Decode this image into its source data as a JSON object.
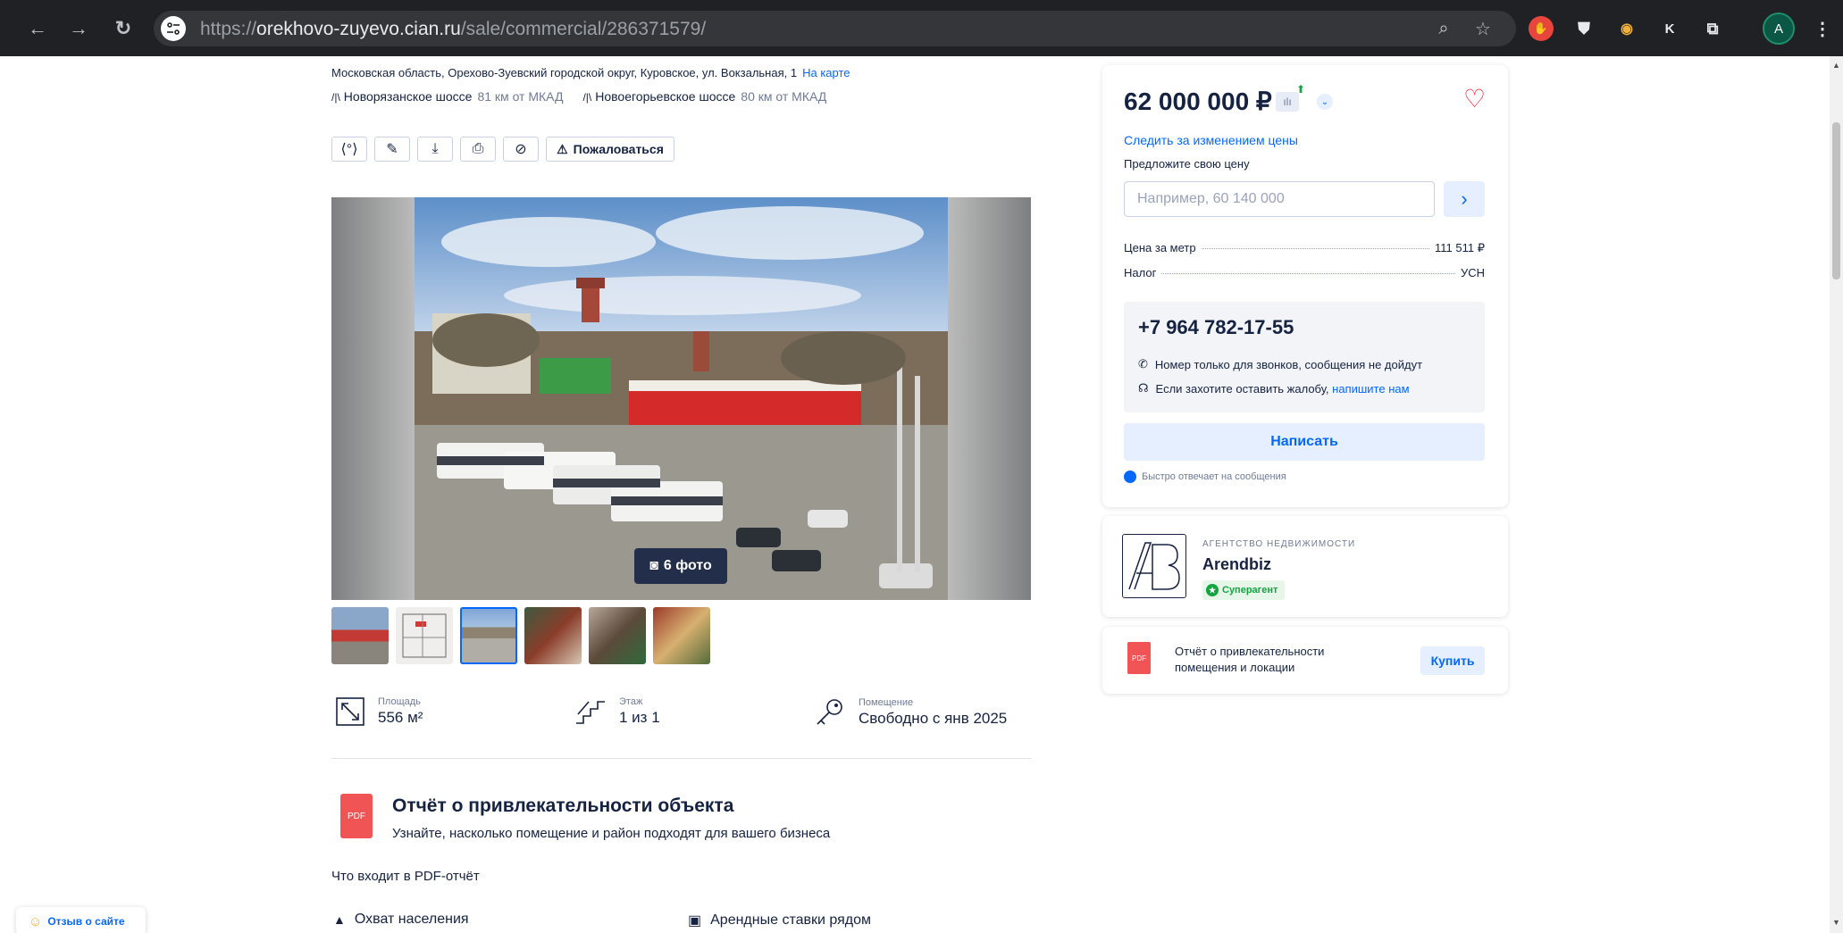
{
  "browser": {
    "url_proto": "https://",
    "url_host": "orekhovo-zuyevo.cian.ru",
    "url_path": "/sale/commercial/286371579/",
    "ext_k": "K",
    "avatar": "A"
  },
  "listing": {
    "address": "Московская область, Орехово-Зуевский городской округ, Куровское, ул. Вокзальная, 1",
    "map_link": "На карте",
    "roads": [
      {
        "name": "Новорязанское шоссе",
        "dist": "81 км от МКАД"
      },
      {
        "name": "Новоегорьевское шоссе",
        "dist": "80 км от МКАД"
      }
    ],
    "complain_label": "Пожаловаться",
    "photo_count": "6 фото",
    "facts": [
      {
        "label": "Площадь",
        "value": "556 м²",
        "icon": "area-icon"
      },
      {
        "label": "Этаж",
        "value": "1 из 1",
        "icon": "stairs-icon"
      },
      {
        "label": "Помещение",
        "value": "Свободно с янв 2025",
        "icon": "key-icon"
      }
    ],
    "report_title": "Отчёт о привлекательности объекта",
    "report_sub": "Узнайте, насколько помещение и район подходят для вашего бизнеса",
    "pdf_contents": "Что входит в PDF-отчёт",
    "features": [
      "Охват населения",
      "Арендные ставки рядом"
    ],
    "pdf_label": "PDF"
  },
  "sidebar": {
    "price": "62 000 000 ₽",
    "follow_price": "Следить за изменением цены",
    "offer_price": "Предложите свою цену",
    "offer_placeholder": "Например, 60 140 000",
    "price_per_meter_label": "Цена за метр",
    "price_per_meter": "111 511 ₽",
    "tax_label": "Налог",
    "tax": "УСН",
    "phone": "+7 964 782-17-55",
    "phone_note": "Номер только для звонков, сообщения не дойдут",
    "complaint_note": "Если захотите оставить жалобу,",
    "complaint_link": "напишите нам",
    "write_button": "Написать",
    "fast_reply": "Быстро отвечает на сообщения",
    "agency_type": "АГЕНТСТВО НЕДВИЖИМОСТИ",
    "agency_name": "Arendbiz",
    "agency_badge": "Суперагент",
    "report_card": "Отчёт о привлекательности помещения и локации",
    "buy_button": "Купить"
  },
  "feedback": "Отзыв о сайте",
  "colors": {
    "accent": "#0468ff",
    "text": "#152242",
    "pdf": "#f05454",
    "heart": "#ff1f34",
    "chrome": "#202124"
  }
}
